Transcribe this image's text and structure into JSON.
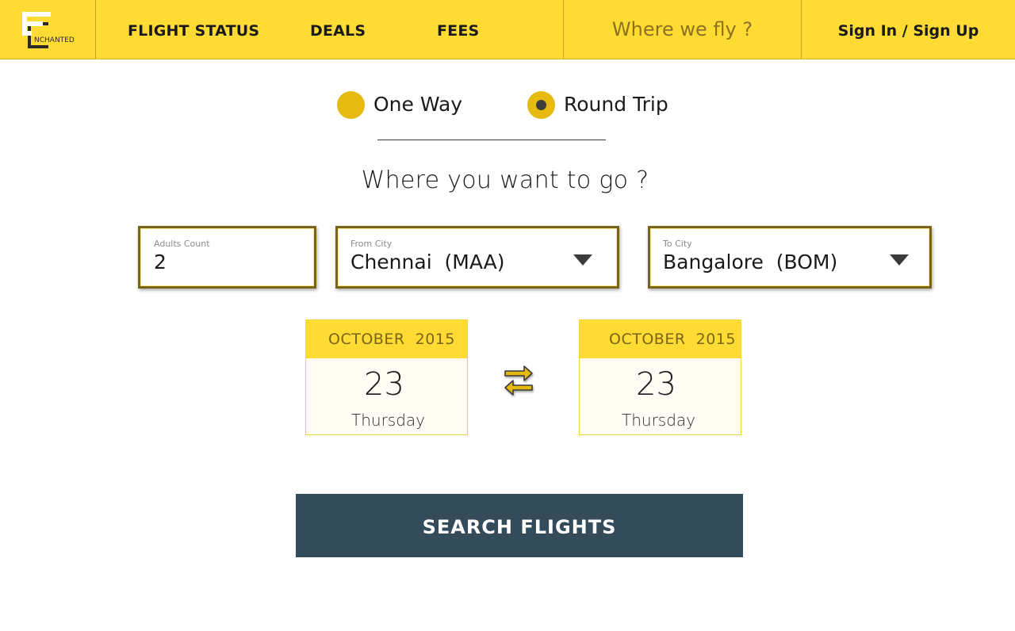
{
  "header": {
    "logo": {
      "letter": "E",
      "text": "NCHANTED"
    },
    "nav": [
      {
        "label": "FLIGHT STATUS"
      },
      {
        "label": "DEALS"
      },
      {
        "label": "FEES"
      }
    ],
    "where_we_fly": "Where we fly ?",
    "sign_in": "Sign In / Sign Up"
  },
  "trip_type": {
    "options": [
      {
        "label": "One Way",
        "selected": false
      },
      {
        "label": "Round Trip",
        "selected": true
      }
    ]
  },
  "prompt": "Where you want to go ?",
  "form": {
    "adults": {
      "label": "Adults Count",
      "value": "2"
    },
    "from": {
      "label": "From City",
      "value": "Chennai  (MAA)"
    },
    "to": {
      "label": "To City",
      "value": "Bangalore  (BOM)"
    }
  },
  "dates": {
    "depart": {
      "month": "OCTOBER  2015",
      "day": "23",
      "weekday": "Thursday"
    },
    "return": {
      "month": "OCTOBER  2015",
      "day": "23",
      "weekday": "Thursday"
    }
  },
  "search_button": "SEARCH FLIGHTS",
  "colors": {
    "brand_yellow": "#ffdb33",
    "radio_yellow": "#e6ba10",
    "button_navy": "#344b5a",
    "border_brown": "#7a6418"
  },
  "icons": {
    "swap": "swap-arrows-icon",
    "dropdown": "caret-down-icon"
  }
}
